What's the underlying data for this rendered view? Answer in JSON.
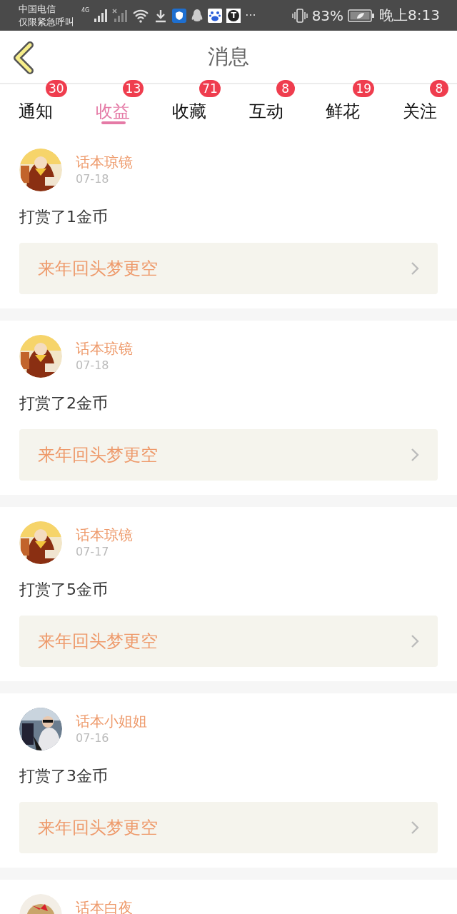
{
  "status_bar": {
    "carrier": "中国电信",
    "carrier_note": "仅限紧急呼叫",
    "network": "4G",
    "app_letter": "T",
    "more": "···",
    "battery": "83%",
    "time": "晚上8:13"
  },
  "header": {
    "title": "消息"
  },
  "tabs": [
    {
      "label": "通知",
      "badge": "30",
      "selected": false
    },
    {
      "label": "收益",
      "badge": "13",
      "selected": true
    },
    {
      "label": "收藏",
      "badge": "71",
      "selected": false
    },
    {
      "label": "互动",
      "badge": "8",
      "selected": false
    },
    {
      "label": "鲜花",
      "badge": "19",
      "selected": false
    },
    {
      "label": "关注",
      "badge": "8",
      "selected": false
    }
  ],
  "messages": [
    {
      "author": "话本琼镜",
      "date": "07-18",
      "text": "打赏了1金币",
      "work": "来年回头梦更空"
    },
    {
      "author": "话本琼镜",
      "date": "07-18",
      "text": "打赏了2金币",
      "work": "来年回头梦更空"
    },
    {
      "author": "话本琼镜",
      "date": "07-17",
      "text": "打赏了5金币",
      "work": "来年回头梦更空"
    },
    {
      "author": "话本小姐姐",
      "date": "07-16",
      "text": "打赏了3金币",
      "work": "来年回头梦更空"
    },
    {
      "author": "话本白夜"
    }
  ]
}
